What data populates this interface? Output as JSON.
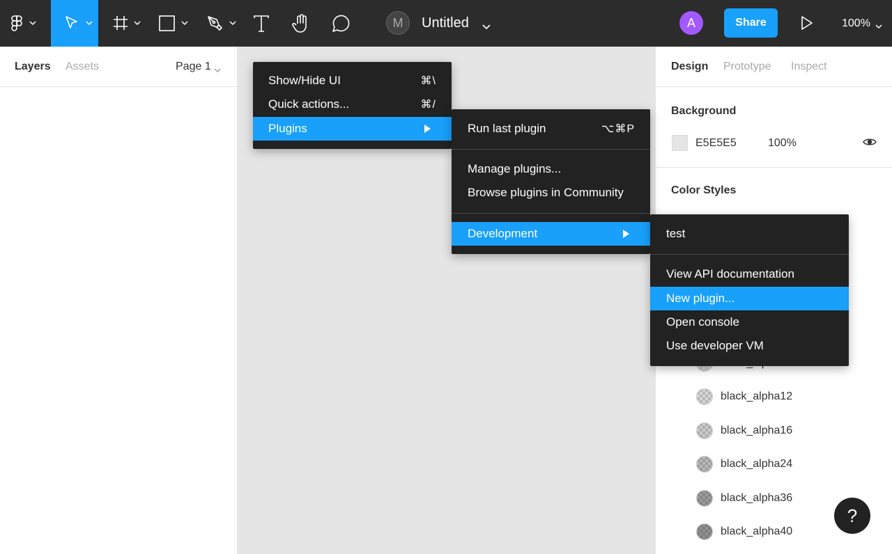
{
  "toolbar": {
    "document_title": "Untitled",
    "collaborator_initial": "M",
    "user_initial": "A",
    "share_label": "Share",
    "zoom": "100%",
    "tools": [
      "figma-menu-icon",
      "move-icon",
      "frame-icon",
      "rectangle-icon",
      "pen-icon",
      "text-icon",
      "hand-icon",
      "comment-icon"
    ]
  },
  "left_panel": {
    "tabs": [
      "Layers",
      "Assets"
    ],
    "page": "Page 1"
  },
  "right_panel": {
    "tabs": [
      "Design",
      "Prototype",
      "Inspect"
    ],
    "background_title": "Background",
    "background_hex": "E5E5E5",
    "background_opacity": "100%",
    "color_styles_title": "Color Styles",
    "styles": [
      {
        "name": "black_alpha12",
        "alpha": 0.12
      },
      {
        "name": "black_alpha16",
        "alpha": 0.16
      },
      {
        "name": "black_alpha24",
        "alpha": 0.24
      },
      {
        "name": "black_alpha36",
        "alpha": 0.36
      },
      {
        "name": "black_alpha40",
        "alpha": 0.4
      }
    ],
    "partially_hidden_style": "black_alpha8"
  },
  "menus": {
    "main": {
      "items": [
        {
          "label": "Show/Hide UI",
          "shortcut": "⌘\\"
        },
        {
          "label": "Quick actions...",
          "shortcut": "⌘/"
        },
        {
          "label": "Plugins",
          "submenu": true
        }
      ]
    },
    "plugins": {
      "run_last": {
        "label": "Run last plugin",
        "shortcut": "⌥⌘P"
      },
      "manage": "Manage plugins...",
      "browse": "Browse plugins in Community",
      "development": "Development"
    },
    "development": {
      "test": "test",
      "api_docs": "View API documentation",
      "new_plugin": "New plugin...",
      "console": "Open console",
      "dev_vm": "Use developer VM"
    }
  },
  "help_label": "?",
  "colors": {
    "toolbar_bg": "#2c2c2c",
    "accent": "#18a0fb",
    "menu_bg": "#222222",
    "canvas": "#e5e5e5",
    "avatar": "#a259ff"
  }
}
